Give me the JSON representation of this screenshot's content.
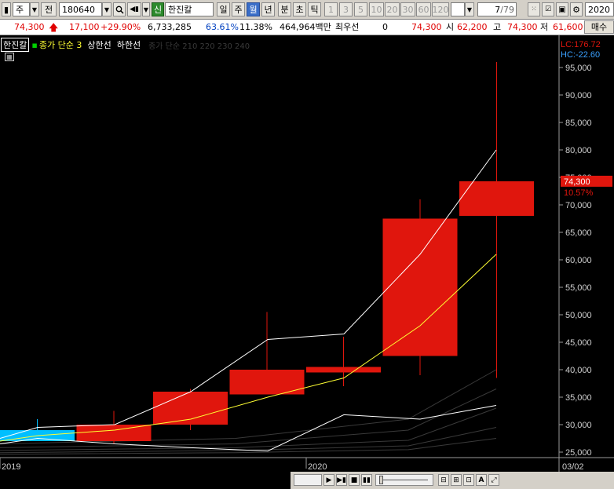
{
  "toolbar": {
    "market": "주",
    "mode": "전",
    "code": "180640",
    "sin_badge": "신",
    "name": "한진칼",
    "periods": [
      "일",
      "주",
      "월",
      "년",
      "분",
      "초",
      "틱"
    ],
    "selected_period": "월",
    "intervals": [
      "1",
      "3",
      "5",
      "10",
      "20",
      "30",
      "60",
      "120"
    ],
    "page": "7",
    "page_total": "/79",
    "date_box": "2020"
  },
  "info": {
    "price": "74,300",
    "change": "17,100",
    "change_pct": "+29.90%",
    "volume": "6,733,285",
    "ratio1": "63.61%",
    "ratio2": "11.38%",
    "amount": "464,964백만",
    "preferred_label": "최우선",
    "preferred_value": "0",
    "current": "74,300",
    "open_label": "시",
    "open": "62,200",
    "high_label": "고",
    "high": "74,300",
    "low_label": "저",
    "low": "61,600",
    "order_btn": "매수"
  },
  "legend": {
    "name": "한진칼",
    "ma_label": "종가 단순 3",
    "upper": "상한선",
    "lower": "하한선",
    "faint": "종가 단순 210 220 230 240"
  },
  "chart_data": {
    "type": "candlestick",
    "x_labels": [
      "2019",
      "2020",
      "03/02"
    ],
    "y_ticks": [
      25000,
      30000,
      35000,
      40000,
      45000,
      50000,
      55000,
      60000,
      65000,
      70000,
      75000,
      80000,
      85000,
      90000,
      95000
    ],
    "ylim": [
      24000,
      98000
    ],
    "candles": [
      {
        "open": 27000,
        "high": 31000,
        "low": 27000,
        "close": 29000,
        "color": "#00bfff"
      },
      {
        "open": 27000,
        "high": 32500,
        "low": 26500,
        "close": 30000,
        "color": "#e0160d"
      },
      {
        "open": 30000,
        "high": 36500,
        "low": 29000,
        "close": 36000,
        "color": "#e0160d"
      },
      {
        "open": 35500,
        "high": 50500,
        "low": 35500,
        "close": 40000,
        "color": "#e0160d"
      },
      {
        "open": 39500,
        "high": 46000,
        "low": 37000,
        "close": 40500,
        "color": "#e0160d"
      },
      {
        "open": 42500,
        "high": 71000,
        "low": 39000,
        "close": 67500,
        "color": "#e0160d"
      },
      {
        "open": 68000,
        "high": 96000,
        "low": 38500,
        "close": 74300,
        "color": "#e0160d"
      }
    ],
    "lines": [
      {
        "name": "종가 단순 3",
        "color": "#ffff33",
        "values": [
          27000,
          28000,
          29000,
          31000,
          35000,
          38500,
          48000,
          61000
        ]
      },
      {
        "name": "상한선",
        "color": "#ffffff",
        "values": [
          27500,
          29500,
          30000,
          36000,
          45500,
          46500,
          61000,
          80000
        ]
      },
      {
        "name": "하한선",
        "color": "#ffffff",
        "values": [
          26500,
          27500,
          26500,
          25800,
          25200,
          31800,
          31000,
          33500
        ]
      }
    ],
    "current_label": "74,300",
    "current_pct": "10.57%",
    "lc_label": "LC:176.72",
    "hc_label": "HC:-22.60"
  }
}
